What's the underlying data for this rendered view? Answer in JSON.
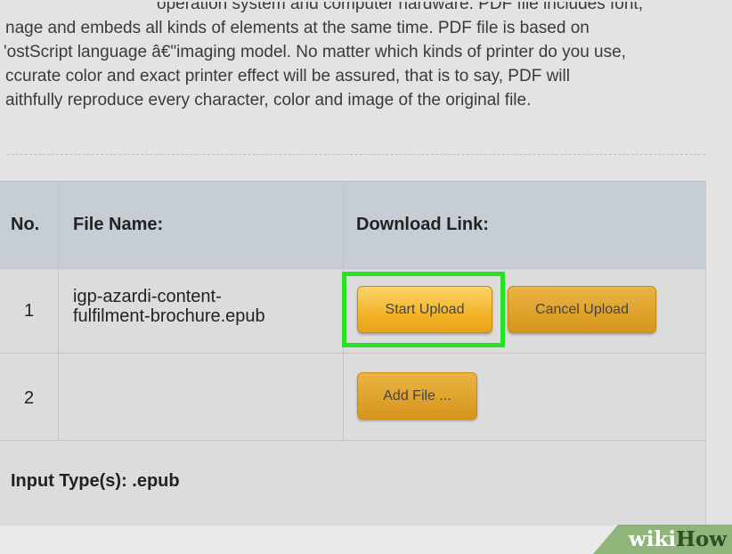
{
  "description": {
    "lines": [
      "operation system and computer hardware. PDF file includes font,",
      "nage and embeds all kinds of elements at the same time. PDF file is based on",
      "'ostScript language â€\"imaging model. No matter which kinds of printer do you use,",
      "ccurate color and exact printer effect will be assured, that is to say, PDF will",
      "aithfully reproduce every character, color and image of the original file."
    ]
  },
  "table": {
    "headers": {
      "no": "No.",
      "file_name": "File Name:",
      "download_link": "Download Link:"
    },
    "rows": [
      {
        "no": "1",
        "file_name_line1": "igp-azardi-content-",
        "file_name_line2": "fulfilment-brochure.epub",
        "start_upload": "Start Upload",
        "cancel_upload": "Cancel Upload"
      },
      {
        "no": "2",
        "add_file": "Add File ..."
      }
    ],
    "input_types": "Input Type(s): .epub"
  },
  "watermark": {
    "part1": "wiki",
    "part2": "How"
  },
  "colors": {
    "highlight": "#25e324",
    "button": "#f3b429",
    "header_bg": "#c7cdd5"
  }
}
